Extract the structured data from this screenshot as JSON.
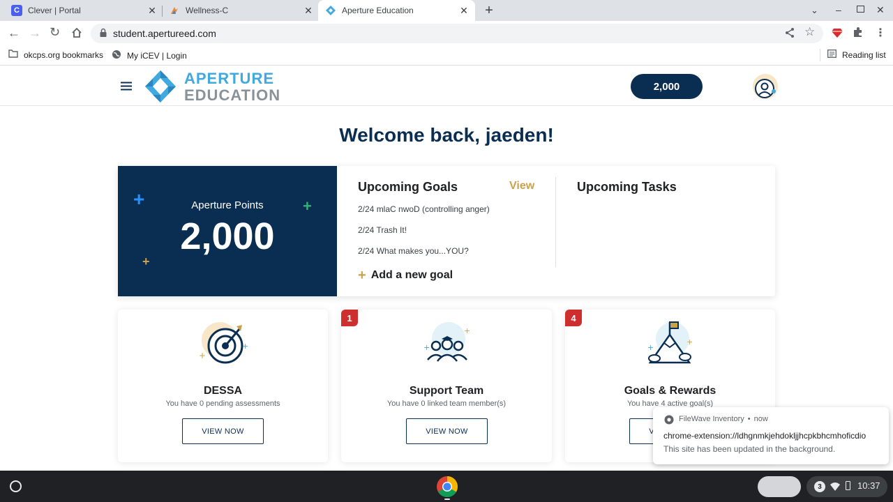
{
  "browser": {
    "tabs": [
      {
        "title": "Clever | Portal",
        "active": false
      },
      {
        "title": "Wellness-C",
        "active": false
      },
      {
        "title": "Aperture Education",
        "active": true
      }
    ],
    "new_tab_symbol": "+",
    "address": "student.apertureed.com",
    "bookmarks": [
      {
        "label": "okcps.org bookmarks",
        "icon": "folder-icon"
      },
      {
        "label": "My iCEV | Login",
        "icon": "globe-icon"
      }
    ],
    "reading_list": "Reading list",
    "clever_icon_letter": "C"
  },
  "app": {
    "logo_line1": "APERTURE",
    "logo_line2": "EDUCATION",
    "points_pill": "2,000",
    "welcome": "Welcome back, jaeden!",
    "points_label": "Aperture Points",
    "points_value": "2,000",
    "upcoming_goals_title": "Upcoming Goals",
    "view_link": "View",
    "goals": [
      "2/24 mlaC nwoD (controlling anger)",
      "2/24 Trash It!",
      "2/24 What makes you...YOU?"
    ],
    "add_goal": "Add a new goal",
    "upcoming_tasks_title": "Upcoming Tasks",
    "cards": [
      {
        "title": "DESSA",
        "subtitle": "You have 0 pending assessments",
        "button": "VIEW NOW",
        "badge": ""
      },
      {
        "title": "Support Team",
        "subtitle": "You have 0 linked team member(s)",
        "button": "VIEW NOW",
        "badge": "1"
      },
      {
        "title": "Goals & Rewards",
        "subtitle": "You have 4 active goal(s)",
        "button": "VIEW NOW",
        "badge": "4"
      }
    ]
  },
  "notification": {
    "source": "FileWave Inventory",
    "dot": "•",
    "time": "now",
    "title": "chrome-extension://ldhgnmkjehdokljjhcpkbhcmhoficdio",
    "body": "This site has been updated in the background."
  },
  "shelf": {
    "notification_count": "3",
    "clock": "10:37"
  },
  "colors": {
    "navy": "#0a2e52",
    "logo_blue": "#3fa9e0",
    "logo_gray": "#8a9299",
    "gold": "#c9a24a",
    "green_plus": "#2bb673",
    "blue_plus": "#2a8ff7",
    "badge_red": "#cf2e2e"
  }
}
